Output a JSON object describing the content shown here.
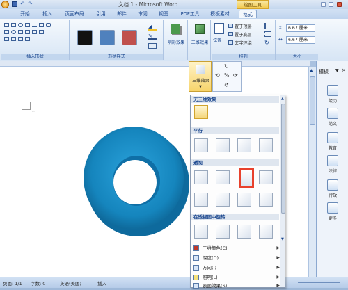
{
  "app": {
    "window_title": "文档 1 - Microsoft Word",
    "context_badge": "绘图工具"
  },
  "tabs": [
    {
      "label": "开始"
    },
    {
      "label": "插入"
    },
    {
      "label": "页面布局"
    },
    {
      "label": "引用"
    },
    {
      "label": "邮件"
    },
    {
      "label": "审阅"
    },
    {
      "label": "视图"
    },
    {
      "label": "PDF工具"
    },
    {
      "label": "模板素材"
    },
    {
      "label": "格式"
    }
  ],
  "ribbon": {
    "group_insert_shapes": "插入形状",
    "group_shape_styles": "形状样式",
    "shadow_effects": "阴影效果",
    "three_d_effects": "三维效果",
    "position": "位置",
    "bring_front": "置于顶层",
    "send_back": "置于底层",
    "text_wrap": "文字环绕",
    "group_arrange": "排列",
    "group_size": "大小",
    "height_value": "6.67 厘米",
    "width_value": "6.67 厘米",
    "style_colors": [
      "#111111",
      "#4f81bd",
      "#c0504d"
    ]
  },
  "popup": {
    "button_label": "三维效果"
  },
  "menu": {
    "none_header": "无三维效果",
    "parallel_header": "平行",
    "perspective_header": "透视",
    "rotate_header": "在透视图中旋转",
    "items": [
      {
        "label": "三维颜色(C)",
        "icon": "paint-icon"
      },
      {
        "label": "深度(D)",
        "icon": "depth-icon"
      },
      {
        "label": "方向(I)",
        "icon": "direction-icon"
      },
      {
        "label": "照明(L)",
        "icon": "light-icon"
      },
      {
        "label": "表面效果(S)",
        "icon": "surface-icon"
      }
    ]
  },
  "sidebar": {
    "title": "模板",
    "items": [
      {
        "label": "箴历"
      },
      {
        "label": "范文"
      },
      {
        "label": "教育"
      },
      {
        "label": "法律"
      },
      {
        "label": "行政"
      },
      {
        "label": "更多"
      }
    ]
  },
  "status": {
    "page": "页面: 1/1",
    "words": "字数: 0",
    "language": "英语(美国)",
    "mode": "插入"
  },
  "colors": {
    "ring": "#1b8ec9",
    "highlight": "#e8412c"
  }
}
